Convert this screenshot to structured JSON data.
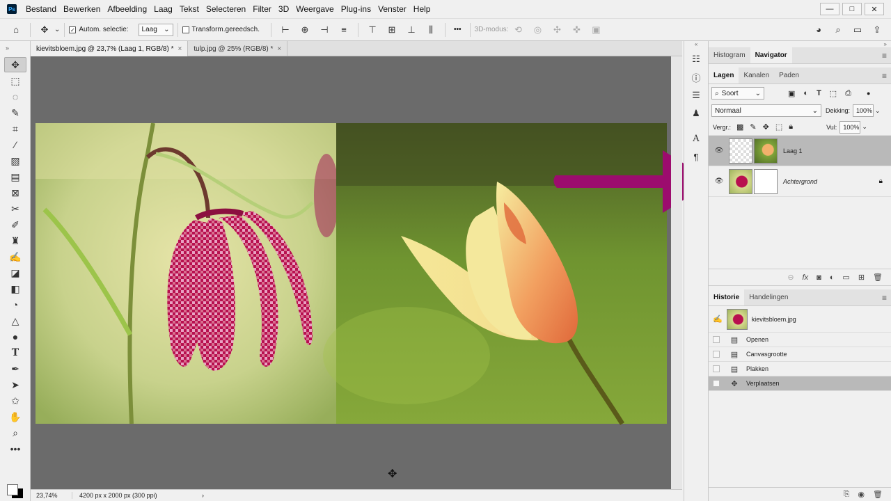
{
  "menubar": {
    "logo": "Ps",
    "items": [
      "Bestand",
      "Bewerken",
      "Afbeelding",
      "Laag",
      "Tekst",
      "Selecteren",
      "Filter",
      "3D",
      "Weergave",
      "Plug-ins",
      "Venster",
      "Help"
    ],
    "window_buttons": [
      "—",
      "□",
      "✕"
    ]
  },
  "options": {
    "auto_select_label": "Autom. selectie:",
    "auto_select_value": "Laag",
    "transform_label": "Transform.gereedsch.",
    "mode_3d_label": "3D-modus:",
    "more": "•••"
  },
  "tabs": [
    {
      "label": "kievitsbloem.jpg @ 23,7% (Laag 1, RGB/8) *",
      "close": "×",
      "active": true
    },
    {
      "label": "tulp.jpg @ 25% (RGB/8) *",
      "close": "×",
      "active": false
    }
  ],
  "status": {
    "zoom": "23,74%",
    "dimensions": "4200 px x 2000 px (300 ppi)",
    "arrow": "›"
  },
  "top_panel": {
    "tabs": [
      "Histogram",
      "Navigator"
    ],
    "active": "Navigator"
  },
  "layers_panel": {
    "tabs": [
      "Lagen",
      "Kanalen",
      "Paden"
    ],
    "active": "Lagen",
    "filter_label": "Soort",
    "blend_mode": "Normaal",
    "opacity_label": "Dekking:",
    "opacity_value": "100%",
    "lock_label": "Vergr.:",
    "fill_label": "Vul:",
    "fill_value": "100%",
    "layers": [
      {
        "name": "Laag 1",
        "selected": true,
        "italic": false
      },
      {
        "name": "Achtergrond",
        "selected": false,
        "italic": true
      }
    ],
    "footer_icons": [
      "link-icon",
      "fx-icon",
      "mask-icon",
      "adjustment-icon",
      "folder-icon",
      "new-layer-icon",
      "trash-icon"
    ]
  },
  "history_panel": {
    "tabs": [
      "Historie",
      "Handelingen"
    ],
    "active": "Historie",
    "snapshot": "kievitsbloem.jpg",
    "states": [
      "Openen",
      "Canvasgrootte",
      "Plakken",
      "Verplaatsen"
    ],
    "selected_state": "Verplaatsen"
  },
  "annotation": {
    "arrow_color": "#9c0c6e"
  },
  "colors": {
    "canvas_bg": "#6b6b6b",
    "panel_bg": "#f0f0f0",
    "selected_row": "#b9b9b9"
  }
}
